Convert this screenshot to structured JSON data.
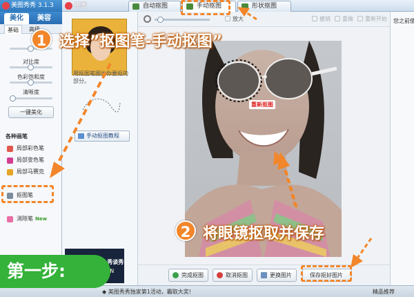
{
  "app": {
    "title": "美图秀秀 3.1.3",
    "subwindow_title": "抠图"
  },
  "tabs": [
    {
      "label": "自动抠图",
      "active": false
    },
    {
      "label": "手动抠图",
      "active": true
    },
    {
      "label": "形状抠图",
      "active": false
    }
  ],
  "sidebar": {
    "tabs": [
      "美化",
      "美容"
    ],
    "subtabs": [
      "基础",
      "高级"
    ],
    "sliders": [
      {
        "label": "对比度",
        "value": 0.5
      },
      {
        "label": "色彩饱和度",
        "value": 0.5
      },
      {
        "label": "清晰度",
        "value": 0.0
      }
    ],
    "one_click_button": "一键美化",
    "tools_section_title": "各种画笔",
    "tools": [
      {
        "label": "局部彩色笔",
        "color": "#e2574c"
      },
      {
        "label": "局部变色笔",
        "color": "#d43d8f"
      },
      {
        "label": "局部马赛克",
        "color": "#e4a626"
      },
      {
        "label": "抠图笔",
        "color": "#7a8b9c"
      },
      {
        "label": "消除笔",
        "color": "#e86fa5",
        "badge": "New"
      }
    ]
  },
  "midpanel": {
    "text": "用抠图笔圈出你要抠的部分。",
    "tutorial_button": "手动抠图教程"
  },
  "canvas": {
    "toolbar": {
      "zoom_label": "放大",
      "undo": "撤销",
      "redo": "重做",
      "restart": "重新开始"
    },
    "redo_cutout_label": "重新抠图",
    "buttons": [
      "完成抠图",
      "取消抠图",
      "更换图片",
      "保存抠好图片"
    ]
  },
  "rightpanel": {
    "text": "您之前使"
  },
  "statusbar": {
    "message": "◆ 美图秀秀独家第1活动，霸取大奖!",
    "right": "精品推荐"
  },
  "ad": {
    "line1": "SHOW, 秀谈秀",
    "line2": "HORIEN"
  },
  "annotations": {
    "step1_number": "1",
    "step1_text": "选择”抠图笔-手动抠图”",
    "step2_number": "2",
    "step2_text": "将眼镜抠取并保存",
    "step_badge": "第一步:"
  },
  "colors": {
    "accent": "#f2862a",
    "step_badge": "#34b23a",
    "title_bar": "#2f78bd"
  }
}
